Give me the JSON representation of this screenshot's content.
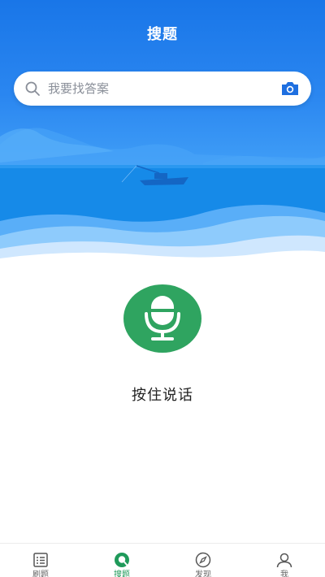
{
  "header": {
    "title": "搜题"
  },
  "search": {
    "placeholder": "我要找答案"
  },
  "voice": {
    "hint": "按住说话"
  },
  "tabs": [
    {
      "label": "刷题",
      "icon": "list-icon",
      "active": false
    },
    {
      "label": "搜题",
      "icon": "search-tab-icon",
      "active": true
    },
    {
      "label": "发现",
      "icon": "compass-icon",
      "active": false
    },
    {
      "label": "我",
      "icon": "user-icon",
      "active": false
    }
  ],
  "colors": {
    "hero_blue": "#1976e8",
    "accent_green": "#2fa460",
    "camera_blue": "#1e6fe0"
  }
}
